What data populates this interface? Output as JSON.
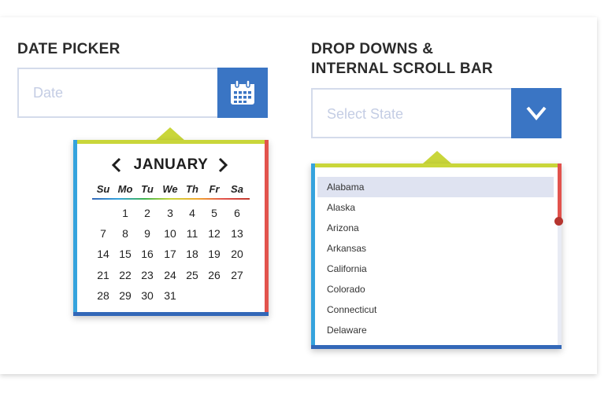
{
  "date_picker": {
    "heading": "DATE PICKER",
    "placeholder": "Date",
    "calendar": {
      "month": "JANUARY",
      "weekdays": [
        "Su",
        "Mo",
        "Tu",
        "We",
        "Th",
        "Fr",
        "Sa"
      ],
      "weeks": [
        [
          "",
          "1",
          "2",
          "3",
          "4",
          "5",
          "6"
        ],
        [
          "7",
          "8",
          "9",
          "10",
          "11",
          "12",
          "13"
        ],
        [
          "14",
          "15",
          "16",
          "17",
          "18",
          "19",
          "20"
        ],
        [
          "21",
          "22",
          "23",
          "24",
          "25",
          "26",
          "27"
        ],
        [
          "28",
          "29",
          "30",
          "31",
          "",
          "",
          ""
        ]
      ]
    },
    "icons": {
      "calendar_button": "calendar-icon",
      "prev": "chevron-left-icon",
      "next": "chevron-right-icon"
    }
  },
  "dropdown": {
    "heading_line1": "DROP DOWNS &",
    "heading_line2": "INTERNAL SCROLL BAR",
    "placeholder": "Select State",
    "options": [
      "Alabama",
      "Alaska",
      "Arizona",
      "Arkansas",
      "California",
      "Colorado",
      "Connecticut",
      "Delaware"
    ],
    "selected_index": 0,
    "scroll_position": 0,
    "icons": {
      "toggle": "chevron-down-icon"
    }
  },
  "colors": {
    "accent_blue": "#3a75c4",
    "border_lime": "#c9d63a",
    "border_cyan": "#35a3dd",
    "border_red": "#e2534d",
    "border_navy": "#3368b8",
    "input_border": "#d4dbeb",
    "placeholder": "#c4cde4",
    "selected_row": "#dfe3f1"
  }
}
